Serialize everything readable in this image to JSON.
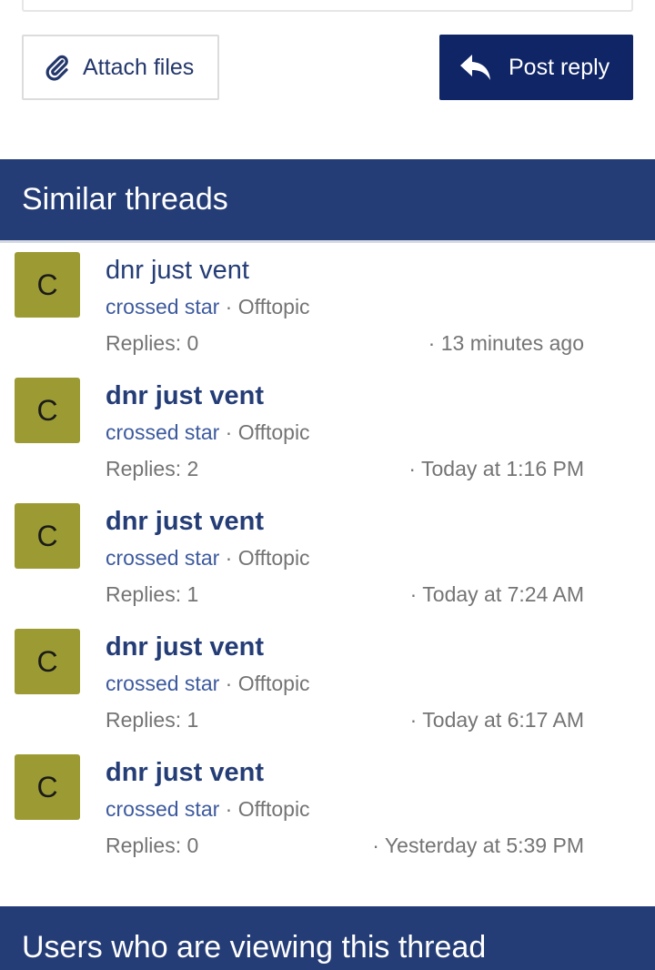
{
  "actions": {
    "attach_label": "Attach files",
    "reply_label": "Post reply"
  },
  "similar": {
    "heading": "Similar threads",
    "threads": [
      {
        "initial": "C",
        "title": "dnr just vent",
        "author": "crossed star",
        "sep": " · ",
        "forum": "Offtopic",
        "replies": "Replies: 0",
        "time": "· 13 minutes ago"
      },
      {
        "initial": "C",
        "title": "dnr just vent",
        "author": "crossed star",
        "sep": " · ",
        "forum": "Offtopic",
        "replies": "Replies: 2",
        "time": "· Today at 1:16 PM"
      },
      {
        "initial": "C",
        "title": "dnr just vent",
        "author": "crossed star",
        "sep": " · ",
        "forum": "Offtopic",
        "replies": "Replies: 1",
        "time": "· Today at 7:24 AM"
      },
      {
        "initial": "C",
        "title": "dnr just vent",
        "author": "crossed star",
        "sep": " · ",
        "forum": "Offtopic",
        "replies": "Replies: 1",
        "time": "· Today at 6:17 AM"
      },
      {
        "initial": "C",
        "title": "dnr just vent",
        "author": "crossed star",
        "sep": " · ",
        "forum": "Offtopic",
        "replies": "Replies: 0",
        "time": "· Yesterday at 5:39 PM"
      }
    ]
  },
  "viewers": {
    "heading": "Users who are viewing this thread"
  },
  "colors": {
    "header_bg": "#253d76",
    "reply_button_bg": "#0f2566",
    "avatar_bg": "#9c9b33",
    "link": "#253d76"
  },
  "icons": {
    "attach": "paperclip-icon",
    "reply": "reply-arrow-icon"
  }
}
